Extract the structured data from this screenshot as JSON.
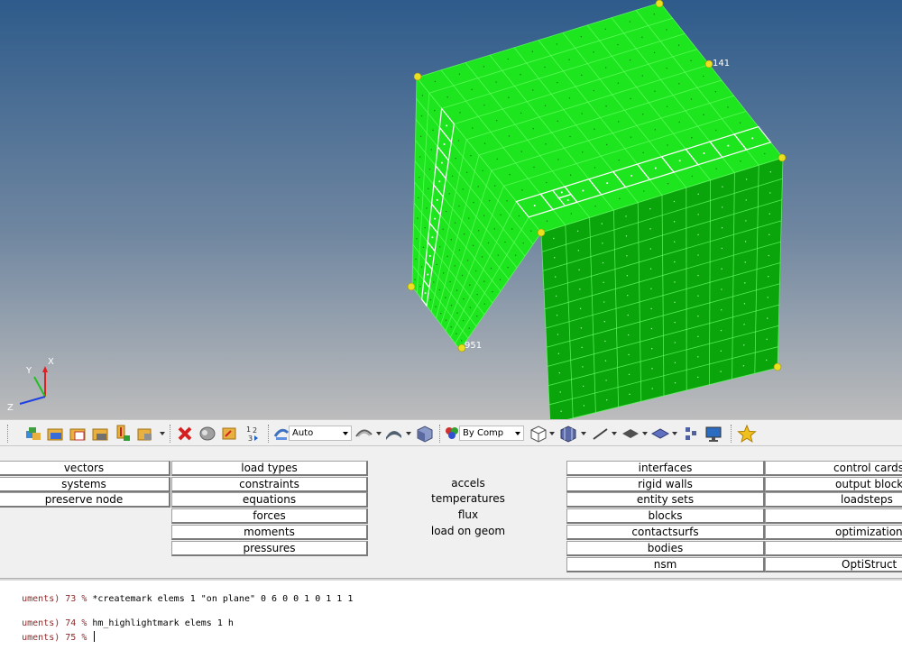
{
  "viewport": {
    "node_labels": {
      "top_right": "141",
      "bottom_left": "951"
    },
    "triad_axes": {
      "x": "X",
      "y": "Y",
      "z": "Z"
    },
    "colors": {
      "background_top": "#2f5c8c",
      "background_bottom": "#b8b8b8",
      "mesh_green": "#1ee61e",
      "mesh_dark": "#0aa50a",
      "highlight": "#ffffff",
      "node_yellow": "#e8e020"
    }
  },
  "toolbar": {
    "graphics_mode": "Auto",
    "color_mode": "By Comp",
    "icons": [
      "assembly-icon",
      "component-icon",
      "include-icon",
      "material-icon",
      "property-icon",
      "load-collector-icon",
      "delete-icon",
      "mask-icon",
      "find-icon",
      "renumber-icon",
      "graphics-icon",
      "shaded-icon",
      "shading-icon",
      "color-icon",
      "mesh-view-icon",
      "box-icon",
      "line-icon",
      "plane-icon",
      "layer-icon",
      "element-icon",
      "display-icon",
      "favorite-star-icon"
    ]
  },
  "panel": {
    "col1": [
      "vectors",
      "systems",
      "preserve node"
    ],
    "col2": [
      "load types",
      "constraints",
      "equations",
      "forces",
      "moments",
      "pressures"
    ],
    "col3": [
      "accels",
      "temperatures",
      "flux",
      "load on geom"
    ],
    "col4": [
      "interfaces",
      "rigid walls",
      "entity sets",
      "blocks",
      "contactsurfs",
      "bodies",
      "nsm"
    ],
    "col5": [
      "control cards",
      "output block",
      "loadsteps",
      "optimization",
      "OptiStruct"
    ]
  },
  "console": {
    "lines": [
      {
        "prefix": "uments) 73 % ",
        "command": "*createmark elems 1 \"on plane\" 0 6 0 0 1 0 1 1 1"
      },
      {
        "prefix": "uments) 74 % ",
        "command": "hm_highlightmark elems 1 h"
      },
      {
        "prefix": "uments) 75 % ",
        "command": ""
      }
    ]
  }
}
